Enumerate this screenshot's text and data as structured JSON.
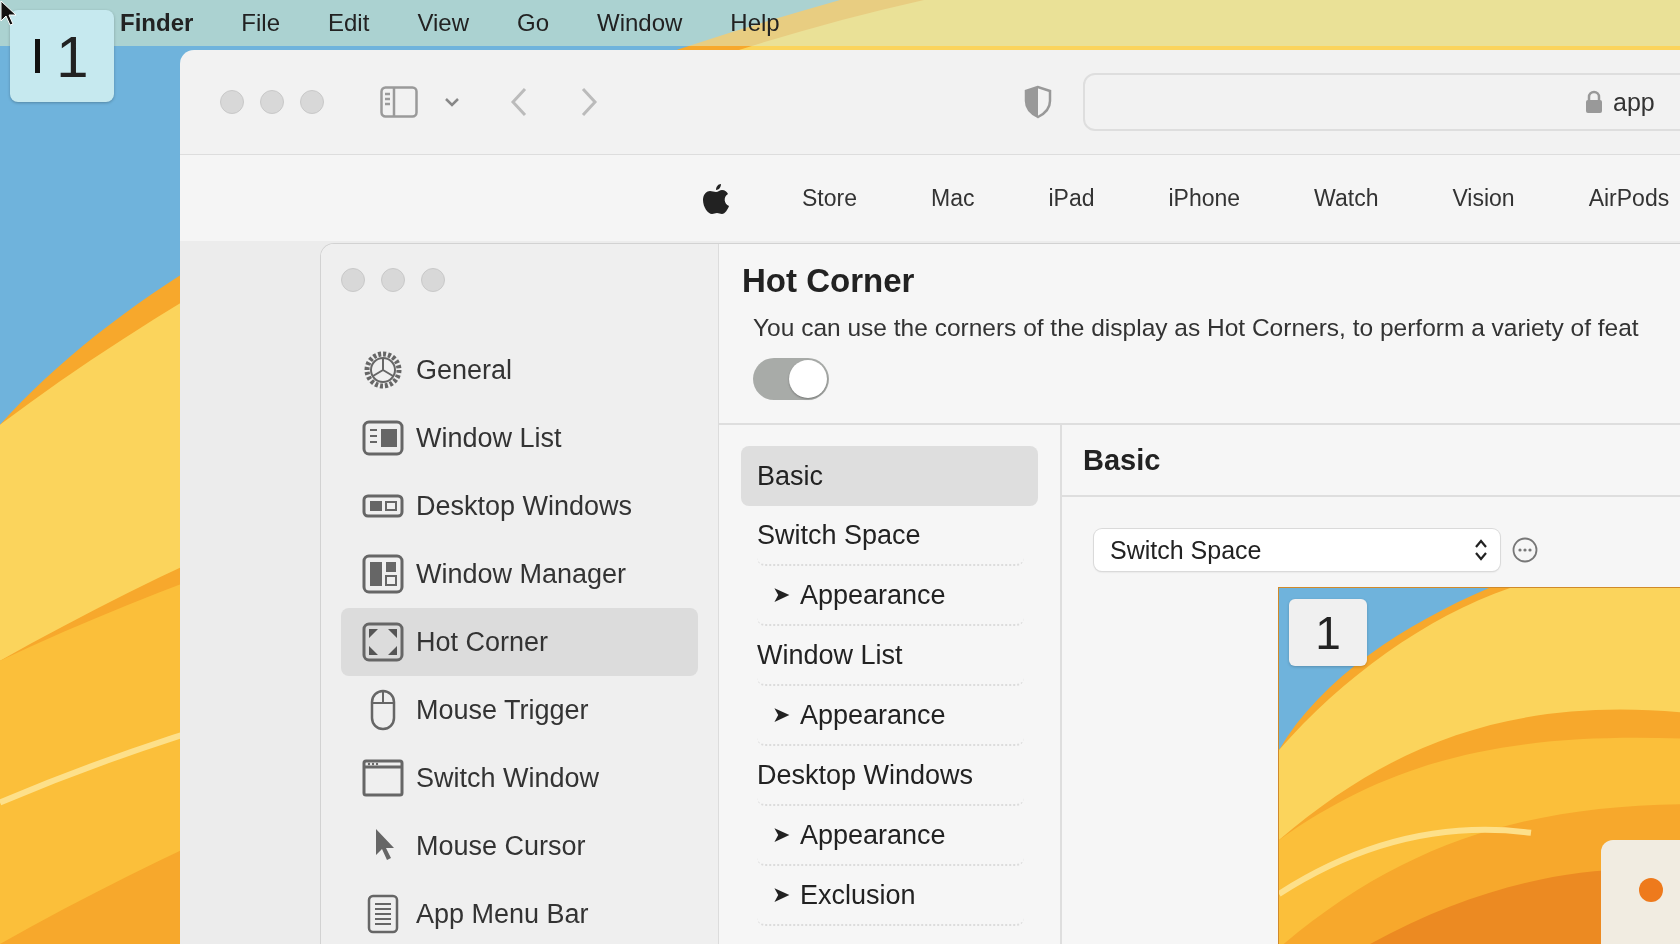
{
  "menu_bar": {
    "app": "Finder",
    "items": [
      "File",
      "Edit",
      "View",
      "Go",
      "Window",
      "Help"
    ]
  },
  "space_badge": {
    "label": "1"
  },
  "browser": {
    "address": "app",
    "nav": [
      "Store",
      "Mac",
      "iPad",
      "iPhone",
      "Watch",
      "Vision",
      "AirPods"
    ]
  },
  "sidebar": [
    {
      "label": "General",
      "kind": "gear",
      "selected": false
    },
    {
      "label": "Window List",
      "kind": "window-list",
      "selected": false
    },
    {
      "label": "Desktop Windows",
      "kind": "desktop-windows",
      "selected": false
    },
    {
      "label": "Window Manager",
      "kind": "window-manager",
      "selected": false
    },
    {
      "label": "Hot Corner",
      "kind": "hot-corner",
      "selected": true
    },
    {
      "label": "Mouse Trigger",
      "kind": "mouse",
      "selected": false
    },
    {
      "label": "Switch Window",
      "kind": "window",
      "selected": false
    },
    {
      "label": "Mouse Cursor",
      "kind": "cursor",
      "selected": false
    },
    {
      "label": "App Menu Bar",
      "kind": "menu-bar",
      "selected": false
    }
  ],
  "header": {
    "title": "Hot Corner",
    "description": "You can use the corners of the display as Hot Corners, to perform a variety of feat",
    "enabled": true
  },
  "sections": [
    {
      "label": "Basic",
      "kind": "section",
      "selected": true
    },
    {
      "label": "Switch Space",
      "kind": "section",
      "selected": false
    },
    {
      "label": "Appearance",
      "kind": "sub",
      "marker": "➤",
      "selected": false
    },
    {
      "label": "Window List",
      "kind": "section",
      "selected": false
    },
    {
      "label": "Appearance",
      "kind": "sub",
      "marker": "➤",
      "selected": false
    },
    {
      "label": "Desktop Windows",
      "kind": "section",
      "selected": false
    },
    {
      "label": "Appearance",
      "kind": "sub",
      "marker": "➤",
      "selected": false
    },
    {
      "label": "Exclusion",
      "kind": "sub",
      "marker": "➤",
      "selected": false
    }
  ],
  "detail": {
    "title": "Basic",
    "action": "Switch Space",
    "preview_badge": "1"
  }
}
